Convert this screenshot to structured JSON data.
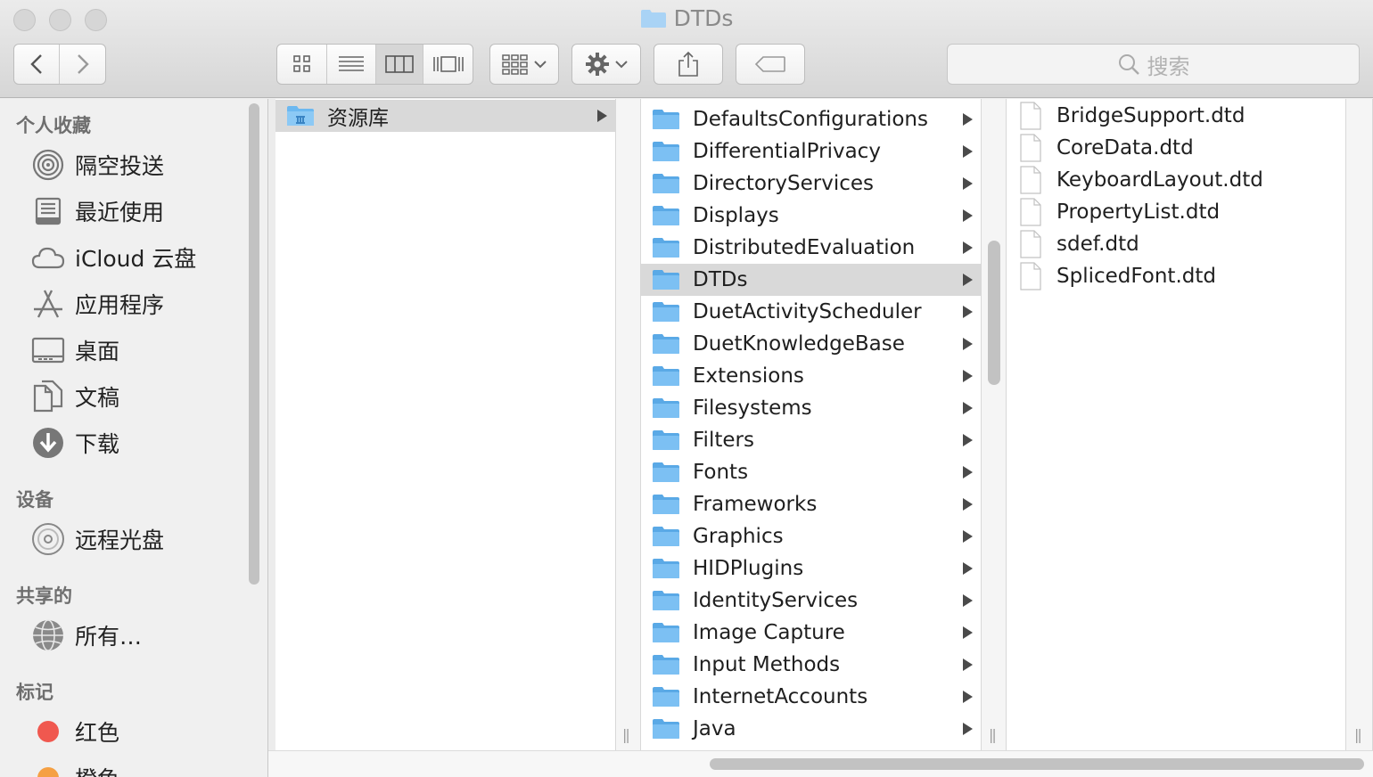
{
  "window": {
    "title": "DTDs"
  },
  "toolbar": {
    "search_placeholder": "搜索"
  },
  "sidebar": {
    "sections": [
      {
        "header": "个人收藏",
        "items": [
          {
            "label": "隔空投送",
            "icon": "airdrop-icon"
          },
          {
            "label": "最近使用",
            "icon": "recents-icon"
          },
          {
            "label": "iCloud 云盘",
            "icon": "cloud-icon"
          },
          {
            "label": "应用程序",
            "icon": "applications-icon"
          },
          {
            "label": "桌面",
            "icon": "desktop-icon"
          },
          {
            "label": "文稿",
            "icon": "documents-icon"
          },
          {
            "label": "下载",
            "icon": "downloads-icon"
          }
        ]
      },
      {
        "header": "设备",
        "items": [
          {
            "label": "远程光盘",
            "icon": "disc-icon"
          }
        ]
      },
      {
        "header": "共享的",
        "items": [
          {
            "label": "所有…",
            "icon": "network-icon"
          }
        ]
      },
      {
        "header": "标记",
        "items": [
          {
            "label": "红色",
            "icon": "tag-red-icon",
            "color": "#f0584f"
          },
          {
            "label": "橙色",
            "icon": "tag-orange-icon",
            "color": "#f5a043"
          }
        ]
      }
    ]
  },
  "column1": {
    "items": [
      {
        "label": "资源库",
        "selected": true
      }
    ]
  },
  "column2": {
    "items": [
      {
        "label": "DefaultsConfigurations"
      },
      {
        "label": "DifferentialPrivacy"
      },
      {
        "label": "DirectoryServices"
      },
      {
        "label": "Displays"
      },
      {
        "label": "DistributedEvaluation"
      },
      {
        "label": "DTDs",
        "selected": true
      },
      {
        "label": "DuetActivityScheduler"
      },
      {
        "label": "DuetKnowledgeBase"
      },
      {
        "label": "Extensions"
      },
      {
        "label": "Filesystems"
      },
      {
        "label": "Filters"
      },
      {
        "label": "Fonts"
      },
      {
        "label": "Frameworks"
      },
      {
        "label": "Graphics"
      },
      {
        "label": "HIDPlugins"
      },
      {
        "label": "IdentityServices"
      },
      {
        "label": "Image Capture"
      },
      {
        "label": "Input Methods"
      },
      {
        "label": "InternetAccounts"
      },
      {
        "label": "Java"
      }
    ]
  },
  "column3": {
    "items": [
      {
        "label": "BridgeSupport.dtd"
      },
      {
        "label": "CoreData.dtd"
      },
      {
        "label": "KeyboardLayout.dtd"
      },
      {
        "label": "PropertyList.dtd"
      },
      {
        "label": "sdef.dtd"
      },
      {
        "label": "SplicedFont.dtd"
      }
    ]
  },
  "colors": {
    "folder": "#6cb8f0",
    "selection": "#d9d9d9"
  }
}
